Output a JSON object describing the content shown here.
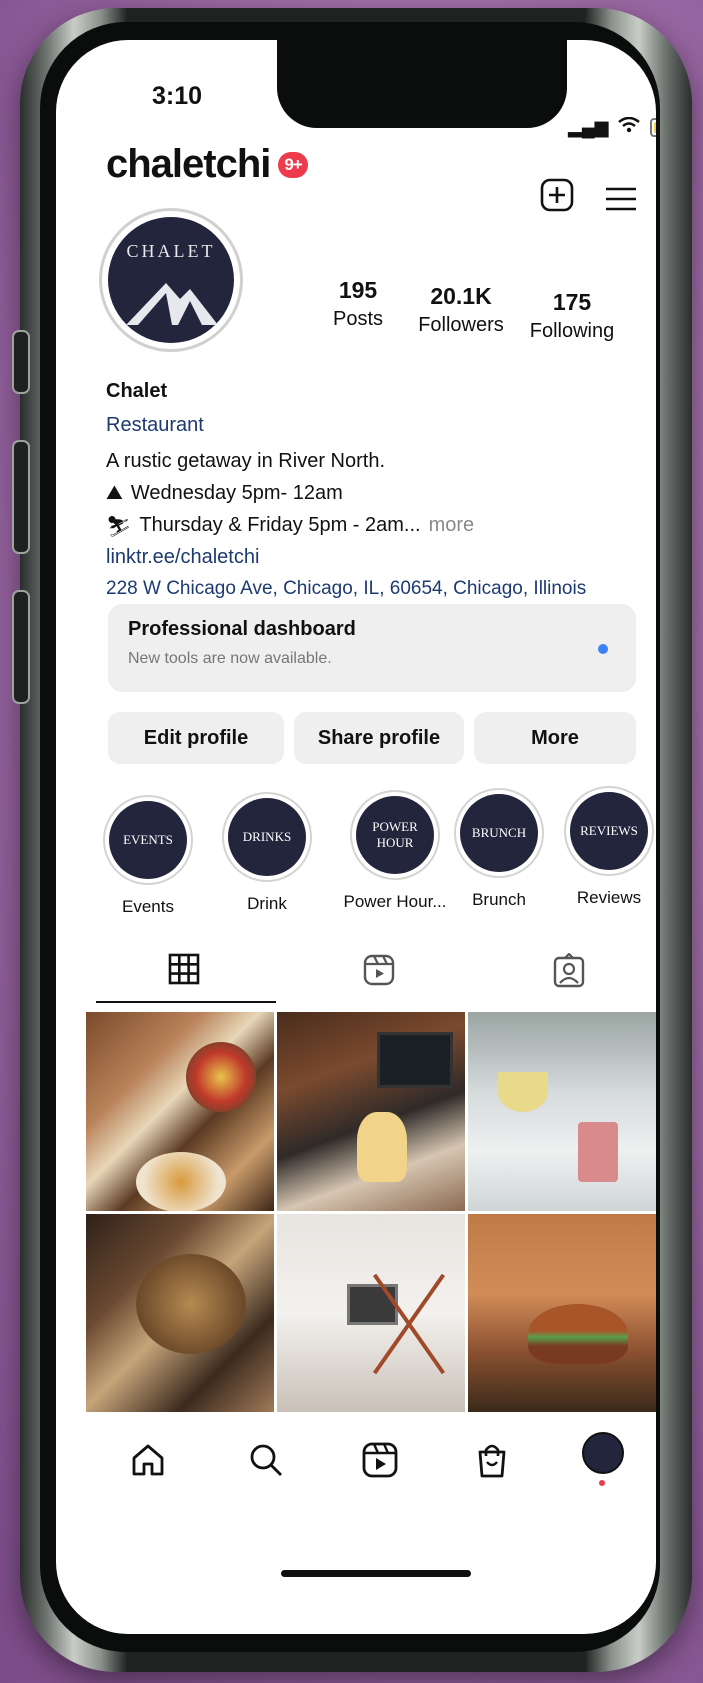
{
  "status_bar": {
    "time": "3:10"
  },
  "profile": {
    "username": "chaletchi",
    "notification_badge": "9+",
    "avatar_text": "CHALET",
    "stats": [
      {
        "value": "195",
        "label": "Posts"
      },
      {
        "value": "20.1K",
        "label": "Followers"
      },
      {
        "value": "175",
        "label": "Following"
      }
    ],
    "name": "Chalet",
    "category": "Restaurant",
    "bio_line1": "A rustic getaway in River North.",
    "bio_line2": "Wednesday 5pm- 12am",
    "bio_line3": "Thursday & Friday 5pm - 2am...",
    "more_label": "more",
    "link": "linktr.ee/chaletchi",
    "address": "228 W Chicago Ave, Chicago, IL, 60654, Chicago, Illinois"
  },
  "dashboard": {
    "title": "Professional dashboard",
    "subtitle": "New tools are now available."
  },
  "buttons": {
    "edit": "Edit profile",
    "share": "Share profile",
    "more": "More"
  },
  "highlights": [
    {
      "cover": "EVENTS",
      "label": "Events"
    },
    {
      "cover": "DRINKS",
      "label": "Drink"
    },
    {
      "cover": "POWER HOUR",
      "label": "Power Hour..."
    },
    {
      "cover": "BRUNCH",
      "label": "Brunch"
    },
    {
      "cover": "REVIEWS",
      "label": "Reviews"
    }
  ],
  "tabs": [
    "grid-icon",
    "reels-icon",
    "tagged-icon"
  ],
  "colors": {
    "accent_blue": "#3b82f6",
    "badge_red": "#ed3b4d",
    "highlight_navy": "#23253d",
    "link_blue": "#1d3a70"
  },
  "bottom_nav": [
    "home-icon",
    "search-icon",
    "reels-icon",
    "shop-icon",
    "profile-avatar"
  ]
}
